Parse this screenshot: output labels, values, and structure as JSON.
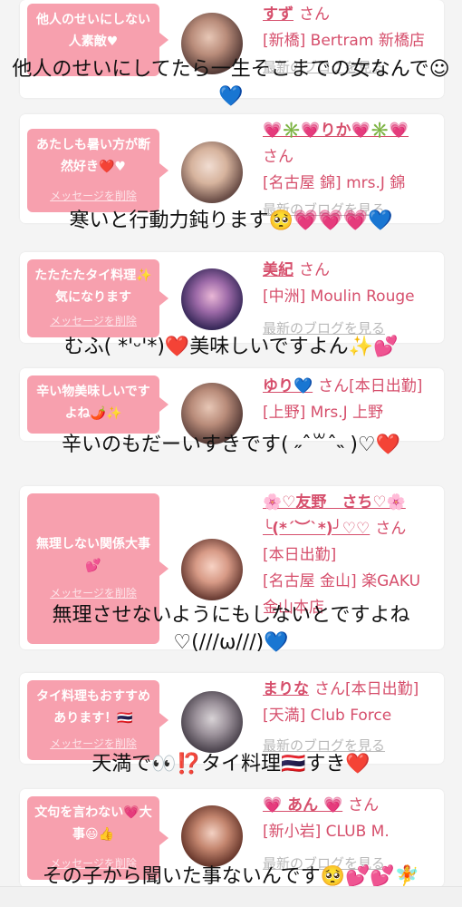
{
  "cards": [
    {
      "bubble": "他人のせいにしない人素敵♥",
      "name": "すず",
      "san": "さん",
      "line2": "[新橋] Bertram 新橋店",
      "line3": "",
      "line4": "",
      "blog": "最新のブログを見る",
      "delete": "",
      "caption": "他人のせいにしてたら一生そこまでの女なんで☺💙"
    },
    {
      "bubble": "あたしも暑い方が断然好き❤️♥",
      "name": "💗✳️💗りか💗✳️💗",
      "san": "さん",
      "line2": "[名古屋 錦] mrs.J 錦",
      "line3": "",
      "line4": "",
      "blog": "最新のブログを見る",
      "delete": "メッセージを削除",
      "caption": "寒いと行動力鈍ります🥺💗💗💗💙"
    },
    {
      "bubble": "たたたたタイ料理✨気になります",
      "name": "美紀",
      "san": "さん",
      "line2": "[中洲] Moulin Rouge",
      "line3": "",
      "line4": "",
      "blog": "最新のブログを見る",
      "delete": "メッセージを削除",
      "caption": "むふ( *'ᵕ'*)❤️美味しいですよん✨💕"
    },
    {
      "bubble": "辛い物美味しいですよね🌶️✨",
      "name": "ゆり💙",
      "san": "さん[本日出勤]",
      "line2": "[上野] Mrs.J 上野",
      "line3": "",
      "line4": "",
      "blog": "",
      "delete": "",
      "caption": "辛いのもだーいすきです( ˶ˆ꒳ˆ˵ )♡❤️"
    },
    {
      "bubble": "無理しない関係大事💕",
      "name": "🌸♡友野　さち♡🌸",
      "san": "さん",
      "line2": "╰(*´︶`*)╯♡♡",
      "line3": "[本日出勤]",
      "line4": "[名古屋 金山] 楽GAKU 金山本店",
      "blog": "",
      "delete": "メッセージを削除",
      "caption": "無理させないようにもしないとですよね",
      "caption2": "♡(///ω///)💙"
    },
    {
      "bubble": "タイ料理もおすすめあります！🇹🇭",
      "name": "まりな",
      "san": "さん[本日出勤]",
      "line2": "[天満] Club Force",
      "line3": "",
      "line4": "",
      "blog": "最新のブログを見る",
      "delete": "メッセージを削除",
      "caption": "天満で👀⁉️タイ料理🇹🇭すき❤️"
    },
    {
      "bubble": "文句を言わない💗大事😃👍",
      "name": "💗 あん 💗",
      "san": "さん",
      "line2": "[新小岩] CLUB M.",
      "line3": "",
      "line4": "",
      "blog": "最新のブログを見る",
      "delete": "メッセージを削除",
      "caption": "その子から聞いた事ないんです🥺💕💕🧚"
    }
  ]
}
